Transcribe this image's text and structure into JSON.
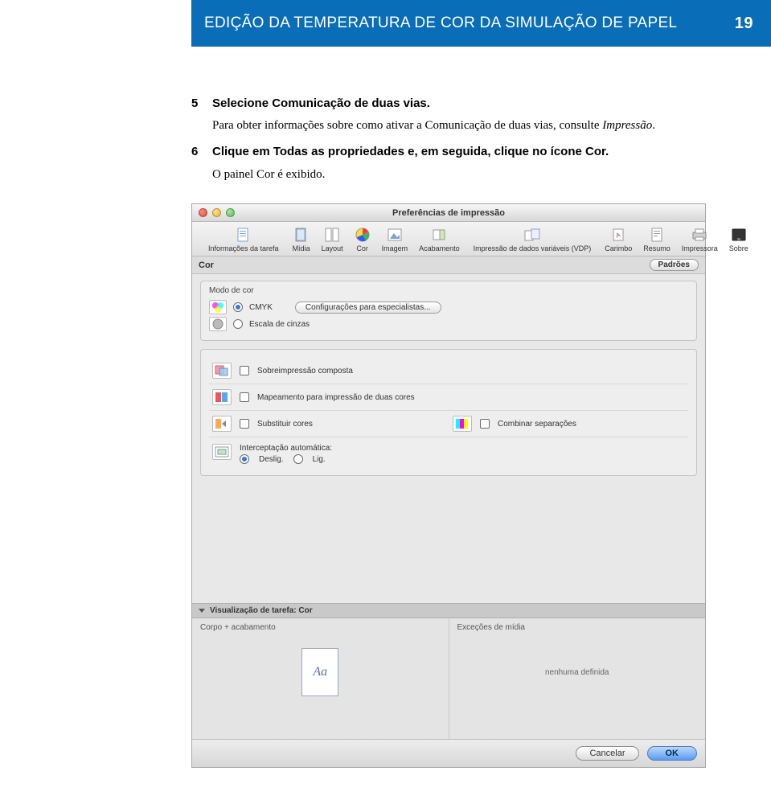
{
  "header": {
    "title": "EDIÇÃO DA TEMPERATURA DE COR DA SIMULAÇÃO DE PAPEL",
    "page": "19"
  },
  "steps": {
    "s5": {
      "num": "5",
      "title": "Selecione Comunicação de duas vias.",
      "desc_pre": "Para obter informações sobre como ativar a Comunicação de duas vias, consulte ",
      "desc_em": "Impressão",
      "desc_post": "."
    },
    "s6": {
      "num": "6",
      "title": "Clique em Todas as propriedades e, em seguida, clique no ícone Cor.",
      "desc": "O painel Cor é exibido."
    }
  },
  "dialog": {
    "window_title": "Preferências de impressão",
    "tabs": [
      {
        "label": "Informações da tarefa"
      },
      {
        "label": "Mídia"
      },
      {
        "label": "Layout"
      },
      {
        "label": "Cor"
      },
      {
        "label": "Imagem"
      },
      {
        "label": "Acabamento"
      },
      {
        "label": "Impressão de dados variáveis (VDP)"
      },
      {
        "label": "Carimbo"
      },
      {
        "label": "Resumo"
      },
      {
        "label": "Impressora"
      },
      {
        "label": "Sobre"
      }
    ],
    "section_title": "Cor",
    "defaults_btn": "Padrões",
    "mode_group": "Modo de cor",
    "mode_cmyk": "CMYK",
    "mode_gray": "Escala de cinzas",
    "expert_btn": "Configurações para especialistas...",
    "opts": {
      "overprint": "Sobreimpressão composta",
      "twocolor": "Mapeamento para impressão de duas cores",
      "subst": "Substituir cores",
      "combine": "Combinar separações",
      "trapping_label": "Interceptação automática:",
      "off": "Deslig.",
      "on": "Lig."
    },
    "preview": {
      "bar": "Visualização de tarefa: Cor",
      "col_body": "Corpo + acabamento",
      "col_media": "Exceções de mídia",
      "thumb": "Aa",
      "none": "nenhuma definida"
    },
    "footer": {
      "cancel": "Cancelar",
      "ok": "OK"
    }
  }
}
